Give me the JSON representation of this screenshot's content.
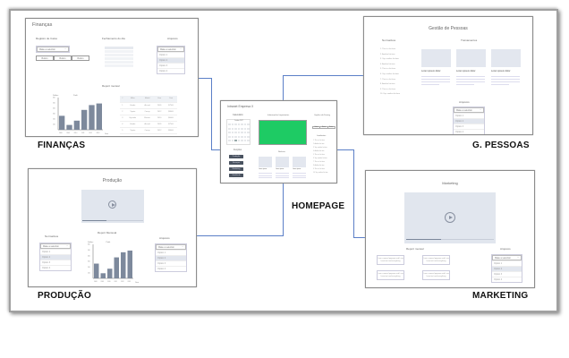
{
  "labels": {
    "financas": "FINANÇAS",
    "pessoas": "G. PESSOAS",
    "homepage": "HOMEPAGE",
    "producao": "PRODUÇÃO",
    "marketing": "MARKETING"
  },
  "common": {
    "select_placeholder": "Make a selection",
    "options": [
      "Option 1",
      "Option 2",
      "Option 3",
      "Option 4"
    ],
    "selected_option": "Option 2",
    "button": "Button"
  },
  "financas": {
    "title": "Finanças",
    "registro": "Registro de Caixa",
    "fechamento": "Fechamento do dia",
    "arquivos": "Arquivos",
    "report": "Report mensal",
    "table": {
      "headers": [
        "#",
        "Make",
        "Model",
        "Year",
        "Cost"
      ],
      "rows": [
        [
          "1",
          "Honda",
          "Accord",
          "2009",
          "$7500"
        ],
        [
          "2",
          "Toyota",
          "Camry",
          "2012",
          "$8000"
        ],
        [
          "3",
          "Hyundai",
          "Elantra",
          "2010",
          "$6000"
        ],
        [
          "4",
          "Honda",
          "Accord",
          "2009",
          "$7500"
        ],
        [
          "5",
          "Toyota",
          "Camry",
          "2012",
          "$8000"
        ]
      ]
    }
  },
  "homepage": {
    "title": "Intranet Empresa X",
    "calendario": "Calendário",
    "month": "October 2017",
    "info": "Informações Importantes",
    "info_color": "#1ecb64",
    "opcoes": "Opções do Desing",
    "opcoes_buttons": [
      "Button",
      "Button",
      "Button"
    ],
    "funcoes": "Funções",
    "funcoes_buttons": [
      "Produção",
      "Finanças",
      "Marketing",
      "Gestão de Pessoas"
    ],
    "noticias": "Notícias",
    "news_title": "Lorem ipsum",
    "lembretes": "Lembretes",
    "lembretes_items": [
      "This is a list item",
      "Another list item",
      "Yep, another list item",
      "Another list item",
      "This is a list item",
      "Yep, another list item",
      "This is a list item",
      "Another list item",
      "This is a list item",
      "Yep, another list item"
    ]
  },
  "pessoas": {
    "title": "Gestão de Pessoas",
    "normativos": "Normativos",
    "treinamentos": "Treinamentos",
    "card_title": "Lorem ipsum dolor",
    "arquivos": "Arquivos",
    "normativos_items": [
      "This is a list item",
      "Another list item",
      "Yep, another list item",
      "Another list item",
      "This is a list item",
      "Yep, another list item",
      "This is a list item",
      "Another list item",
      "This is a list item",
      "Yep, another list item"
    ]
  },
  "producao": {
    "title": "Produção",
    "normativos": "Normativos",
    "report": "Report Mensual",
    "arquivos": "Arquivos",
    "video_progress": 0.4
  },
  "marketing": {
    "title": "Marketing",
    "report": "Report mensal",
    "arquivos": "Arquivos",
    "video_progress": 0.4,
    "bubble_text": "I am a normal popover and I can have text and everything"
  },
  "chart_data": [
    {
      "type": "bar",
      "ylabel": "Dollars",
      "title": "Profit",
      "xlabel": "Year",
      "categories": [
        "2008",
        "2009",
        "2010",
        "2011",
        "2012",
        "2013"
      ],
      "values": [
        260,
        90,
        170,
        370,
        460,
        490
      ],
      "ylim": [
        0,
        600
      ]
    },
    {
      "type": "bar",
      "ylabel": "Dollars",
      "title": "Profit",
      "xlabel": "Year",
      "categories": [
        "2008",
        "2009",
        "2010",
        "2011",
        "2012",
        "2013"
      ],
      "values": [
        260,
        90,
        170,
        370,
        460,
        490
      ],
      "ylim": [
        0,
        600
      ]
    }
  ]
}
